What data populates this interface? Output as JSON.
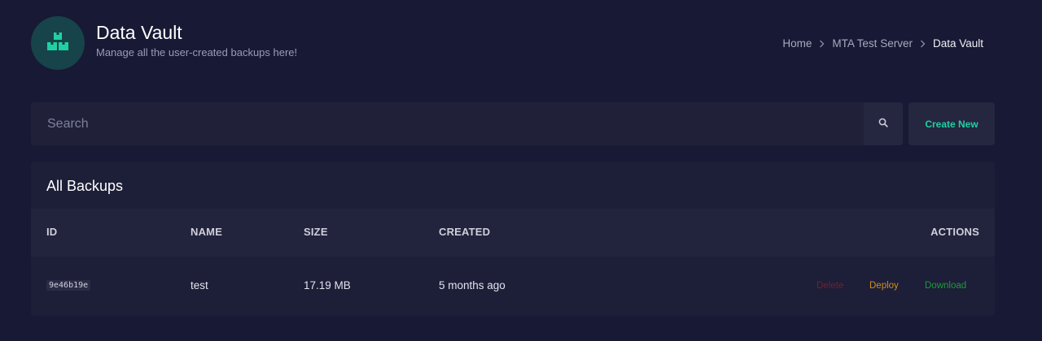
{
  "header": {
    "title": "Data Vault",
    "subtitle": "Manage all the user-created backups here!",
    "logo_icon": "boxes-icon",
    "breadcrumb": [
      "Home",
      "MTA Test Server",
      "Data Vault"
    ]
  },
  "search": {
    "placeholder": "Search",
    "value": "",
    "button_icon": "search-icon"
  },
  "toolbar": {
    "create_label": "Create New"
  },
  "backups": {
    "title": "All Backups",
    "columns": [
      "ID",
      "NAME",
      "SIZE",
      "CREATED",
      "ACTIONS"
    ],
    "rows": [
      {
        "id": "9e46b19e",
        "name": "test",
        "size": "17.19 MB",
        "created": "5 months ago",
        "actions": [
          "Delete",
          "Deploy",
          "Download"
        ]
      }
    ]
  },
  "colors": {
    "background": "#181934",
    "accent": "#1fd1a2",
    "delete": "#7a1f2a",
    "deploy": "#d0901c",
    "download": "#1f9a3c"
  }
}
